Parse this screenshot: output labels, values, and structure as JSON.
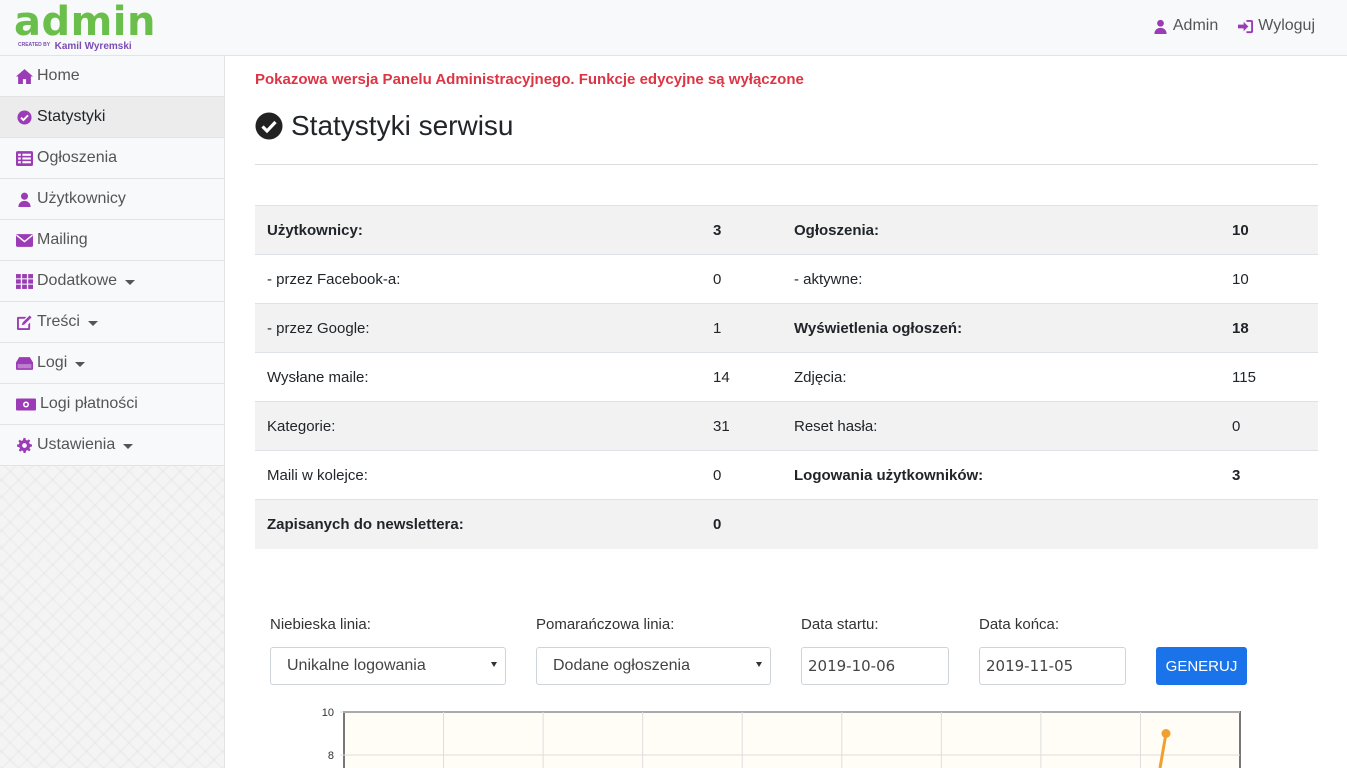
{
  "header": {
    "logo": {
      "word": "admin",
      "created_by": "CREATED BY",
      "author": "Kamil Wyremski"
    },
    "user_link": "Admin",
    "logout_link": "Wyloguj"
  },
  "sidebar": {
    "items": [
      {
        "label": "Home",
        "icon": "home-icon"
      },
      {
        "label": "Statystyki",
        "icon": "check-circle-icon",
        "active": true
      },
      {
        "label": "Ogłoszenia",
        "icon": "list-icon"
      },
      {
        "label": "Użytkownicy",
        "icon": "user-icon"
      },
      {
        "label": "Mailing",
        "icon": "envelope-icon"
      },
      {
        "label": "Dodatkowe",
        "icon": "grid-icon",
        "dropdown": true
      },
      {
        "label": "Treści",
        "icon": "edit-icon",
        "dropdown": true
      },
      {
        "label": "Logi",
        "icon": "hdd-icon",
        "dropdown": true
      },
      {
        "label": "Logi płatności",
        "icon": "money-icon"
      },
      {
        "label": "Ustawienia",
        "icon": "gear-icon",
        "dropdown": true
      }
    ]
  },
  "main": {
    "notice": "Pokazowa wersja Panelu Administracyjnego. Funkcje edycyjne są wyłączone",
    "title": "Statystyki serwisu",
    "stats": [
      {
        "l1": "Użytkownicy:",
        "v1": "3",
        "l2": "Ogłoszenia:",
        "v2": "10"
      },
      {
        "l1": "- przez Facebook-a:",
        "v1": "0",
        "l2": "- aktywne:",
        "v2": "10"
      },
      {
        "l1": "- przez Google:",
        "v1": "1",
        "l2": "Wyświetlenia ogłoszeń:",
        "v2": "18"
      },
      {
        "l1": "Wysłane maile:",
        "v1": "14",
        "l2": "Zdjęcia:",
        "v2": "115"
      },
      {
        "l1": "Kategorie:",
        "v1": "31",
        "l2": "Reset hasła:",
        "v2": "0"
      },
      {
        "l1": "Maili w kolejce:",
        "v1": "0",
        "l2": "Logowania użytkowników:",
        "v2": "3"
      },
      {
        "l1": "Zapisanych do newslettera:",
        "v1": "0",
        "l2": "",
        "v2": ""
      }
    ],
    "form": {
      "blue_label": "Niebieska linia:",
      "blue_value": "Unikalne logowania",
      "orange_label": "Pomarańczowa linia:",
      "orange_value": "Dodane ogłoszenia",
      "start_label": "Data startu:",
      "start_value": "2019-10-06",
      "end_label": "Data końca:",
      "end_value": "2019-11-05",
      "button": "GENERUJ"
    }
  },
  "chart_data": {
    "type": "line",
    "y_ticks": [
      "10",
      "8"
    ],
    "ylim": [
      0,
      10
    ],
    "series": [
      {
        "color": "#f0a030",
        "values": [
          9
        ]
      }
    ],
    "background": "#fffdf5",
    "grid": true
  }
}
